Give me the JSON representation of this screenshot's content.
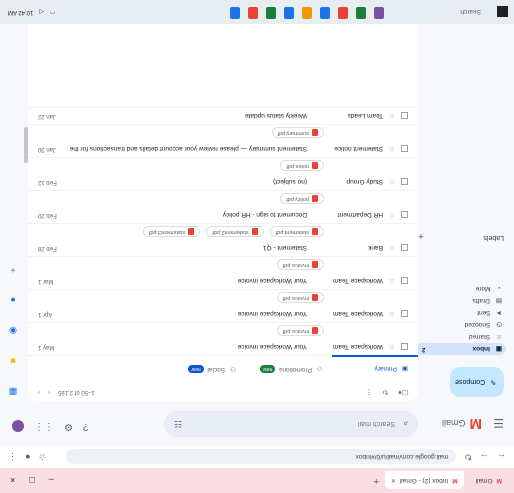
{
  "browser": {
    "tabs": [
      {
        "label": "Gmail"
      },
      {
        "label": "Inbox (2) - Gmail",
        "active": true
      }
    ],
    "url": "mail.google.com/mail/u/0/#inbox"
  },
  "gmail": {
    "brand": "Gmail",
    "search_placeholder": "Search mail",
    "compose_label": "Compose",
    "nav": [
      {
        "label": "Inbox",
        "count": "2",
        "active": true
      },
      {
        "label": "Starred"
      },
      {
        "label": "Snoozed"
      },
      {
        "label": "Sent"
      },
      {
        "label": "Drafts"
      },
      {
        "label": "More"
      }
    ],
    "labels_heading": "Labels"
  },
  "toolbar": {
    "range": "1–50 of 2,195"
  },
  "category_tabs": [
    {
      "label": "Primary",
      "active": true
    },
    {
      "label": "Promotions",
      "sub": "",
      "badge": "new"
    },
    {
      "label": "Social",
      "sub": "",
      "badge": "new"
    }
  ],
  "emails": [
    {
      "sender": "Workspace Team",
      "subject": "Your Workspace invoice",
      "date": "May 1",
      "attachments": [
        "invoice.pdf"
      ]
    },
    {
      "sender": "Workspace Team",
      "subject": "Your Workspace invoice",
      "date": "Apr 1",
      "attachments": [
        "invoice.pdf"
      ]
    },
    {
      "sender": "Workspace Team",
      "subject": "Your Workspace invoice",
      "date": "Mar 1",
      "attachments": [
        "invoice.pdf"
      ]
    },
    {
      "sender": "Bank",
      "subject": "Statement - Q1",
      "date": "Feb 28",
      "attachments": [
        "statement.pdf",
        "statement2.pdf",
        "statement3.pdf"
      ]
    },
    {
      "sender": "HR Department",
      "subject": "Document to sign - HR policy",
      "date": "Feb 20",
      "attachments": [
        "policy.pdf"
      ]
    },
    {
      "sender": "Study Group",
      "subject": "(no subject)",
      "date": "Feb 12",
      "attachments": [
        "notes.pdf"
      ]
    },
    {
      "sender": "Statement notice",
      "subject": "Statement summary — please review your account details and transactions for the period ending",
      "date": "Jan 30",
      "attachments": [
        "summary.pdf"
      ]
    },
    {
      "sender": "Team Leads",
      "subject": "Weekly status update",
      "date": "Jan 22",
      "attachments": []
    }
  ],
  "taskbar": {
    "search": "Search",
    "clock": "10:42 AM"
  },
  "colors": {
    "pdf": "#ea4335",
    "compose": "#c2e7ff",
    "active_nav": "#d3e3fd",
    "accent": "#0b57d0"
  }
}
